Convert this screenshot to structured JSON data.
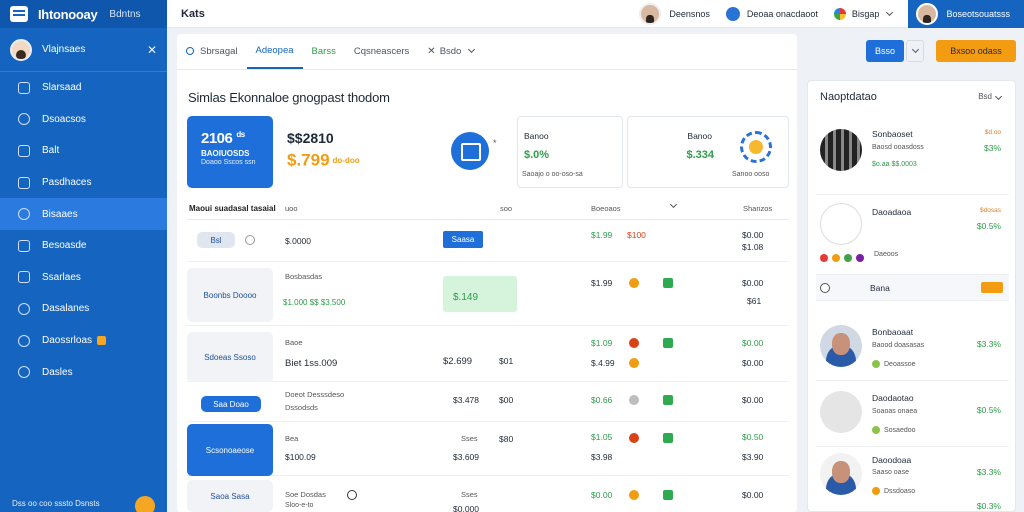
{
  "colors": {
    "sidebar": "#1565c0",
    "accent": "#1e6fd9",
    "orange": "#f39c12",
    "green": "#2e9c4a",
    "red": "#d84315"
  },
  "sidebar": {
    "brand": "Ihtonooay",
    "brand_sub": "Bdntns",
    "user_name": "Vlajnsaes",
    "close_icon": "close-icon",
    "items": [
      {
        "label": "Slarsaad",
        "icon": "dashboard-icon"
      },
      {
        "label": "Dsoacsos",
        "icon": "search-icon"
      },
      {
        "label": "Balt",
        "icon": "chart-icon"
      },
      {
        "label": "Pasdhaces",
        "icon": "document-icon"
      },
      {
        "label": "Bisaaes",
        "icon": "globe-icon"
      },
      {
        "label": "Besoasde",
        "icon": "inbox-icon"
      },
      {
        "label": "Ssarlaes",
        "icon": "grid-icon"
      },
      {
        "label": "Dasalanes",
        "icon": "clock-icon"
      },
      {
        "label": "Daossrloas",
        "icon": "history-icon"
      },
      {
        "label": "Dasles",
        "icon": "settings-icon"
      }
    ],
    "footer": "Dss oo coo sssto Dsnsts"
  },
  "topbar": {
    "title": "Kats",
    "user1": "Deensnos",
    "user2": "Deoaa onacdaoot",
    "lang": "Bisgap",
    "user3": "Boseotsouatsss"
  },
  "tabs": [
    {
      "label": "Sbrsagal"
    },
    {
      "label": "Adeopea"
    },
    {
      "label": "Barss"
    },
    {
      "label": "Cqsneascers"
    },
    {
      "label": "Bsdo"
    }
  ],
  "actions": {
    "primary": "Bsso",
    "secondary": "Bxsoo odass"
  },
  "page_heading": "Simlas Ekonnaloe gnogpast thodom",
  "kpis": {
    "main": {
      "big": "2106",
      "unit": "ds",
      "line1": "BAOIUOSDS",
      "line2": "Doaoo Sscos ssn"
    },
    "mid": {
      "v1": "$$2810",
      "v2": "$.799",
      "v2_small": "do-doo",
      "aside": "*"
    },
    "card1": {
      "title": "Banoo",
      "value": "$.0%",
      "sub": "Saoajo o oo-oso-sa"
    },
    "card2": {
      "title": "Banoo",
      "value": "$.334",
      "sub": "Sanoo ooso"
    }
  },
  "table": {
    "headers": [
      "Maoui suadasal tasaial",
      "uoo",
      "soo",
      "Boeoaos",
      "Shanzos"
    ],
    "rows": [
      {
        "box": "Bsl",
        "c1": "$.0000",
        "pill": "Saasa",
        "c3": "$1.99",
        "c4": "$100",
        "c5": "$0.00",
        "c5b": "$1.08"
      },
      {
        "box": "Boonbs Doooo",
        "c1": "Bosbasdas",
        "c1b": "$1.000 $$ $3.500",
        "c2": "$.149",
        "c3": "$1.99",
        "c5": "$0.00",
        "c5b": "$61"
      },
      {
        "box": "Sdoeas Ssoso",
        "c1": "Baoe",
        "c1b": "Biet 1ss.009",
        "c2": "$2.699",
        "c2b": "$01",
        "c3": "$1.09",
        "c3b": "$.4.99",
        "c5": "$0.00",
        "c5b": "$0.00"
      },
      {
        "box": "Saa Doao",
        "c1": "Doeot Desssdeso",
        "c1b": "Dssodsds",
        "c2": "$3.478",
        "c2b": "$00",
        "c3": "$0.66",
        "c5": "$0.00"
      },
      {
        "box": "Scsonoaeose",
        "c1": "Bea",
        "c1b": "$100.09",
        "c2": "Sses",
        "c2b": "$3.609",
        "c2c": "$80",
        "c3": "$1.05",
        "c3b": "$3.98",
        "c5": "$0.50",
        "c5b": "$3.90"
      },
      {
        "box": "Saoa Sasa",
        "c1": "Soe Dosdas",
        "c1b": "Sloo-e-to",
        "c2": "Sses",
        "c2b": "$0.000",
        "c3": "$0.00",
        "c5": "$0.00"
      }
    ]
  },
  "right_panel": {
    "title": "Naoptdatao",
    "filter": "Bsd",
    "items": [
      {
        "name": "Sonbaoset",
        "sub": "Baosd ooasdoss",
        "line": "$o.aa $$.0003",
        "value": "$3%",
        "small": "$d.oo"
      },
      {
        "name": "Daoadaoa",
        "sub": "",
        "line": "Daeoos",
        "value": "$0.5%",
        "small": "$dosas"
      },
      {
        "name": "Bana",
        "value": "",
        "orange": true
      },
      {
        "name": "Bonbaoaat",
        "sub": "Baood doasasas",
        "line": "Deoassoe",
        "value": "$3.3%"
      },
      {
        "name": "Daodaotao",
        "sub": "Soaoas onaea",
        "line": "Sosaedoo",
        "value": "$0.5%"
      },
      {
        "name": "Daoodoaa",
        "sub": "Saaso oase",
        "line": "Dssdoaso",
        "value": "$3.3%",
        "value2": "$0.3%"
      }
    ]
  }
}
